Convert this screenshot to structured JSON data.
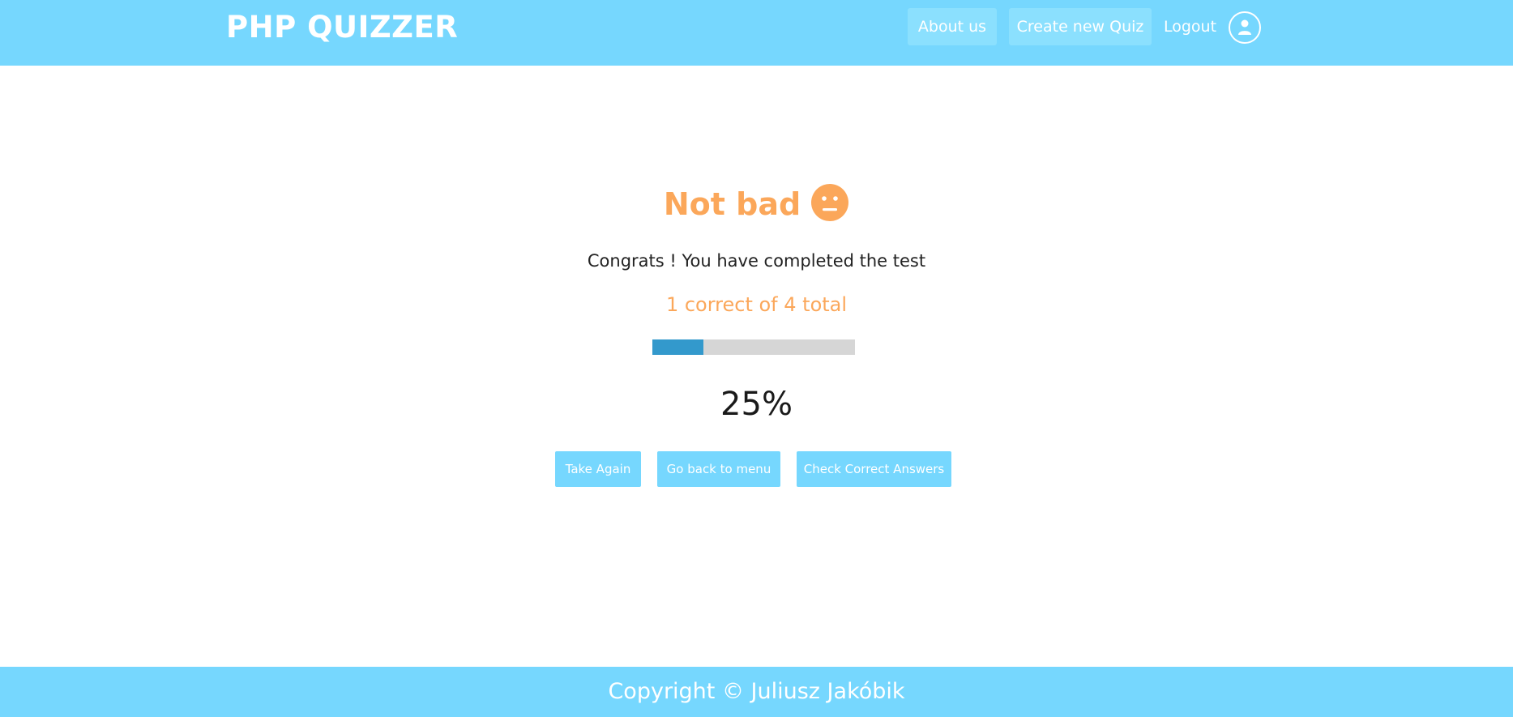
{
  "header": {
    "brand": "PHP QUIZZER",
    "nav": {
      "about": "About us",
      "create": "Create new Quiz",
      "logout": "Logout"
    },
    "avatar_icon": "user-icon"
  },
  "result": {
    "heading": "Not bad",
    "face_icon": "neutral-face-icon",
    "message": "Congrats ! You have completed the test",
    "score": "1 correct of 4 total",
    "progress": 0.25,
    "percent_label": "25%"
  },
  "actions": {
    "take_again": "Take Again",
    "back_to_menu": "Go back to menu",
    "check_answers": "Check Correct Answers"
  },
  "footer": {
    "copyright": "Copyright © Juliusz Jakóbik"
  },
  "colors": {
    "header_bg": "#76d7fe",
    "nav_button_bg": "#8be0fe",
    "accent_orange": "#fba75a",
    "progress_fill": "#3399cc",
    "progress_track": "#d6d6d6"
  }
}
